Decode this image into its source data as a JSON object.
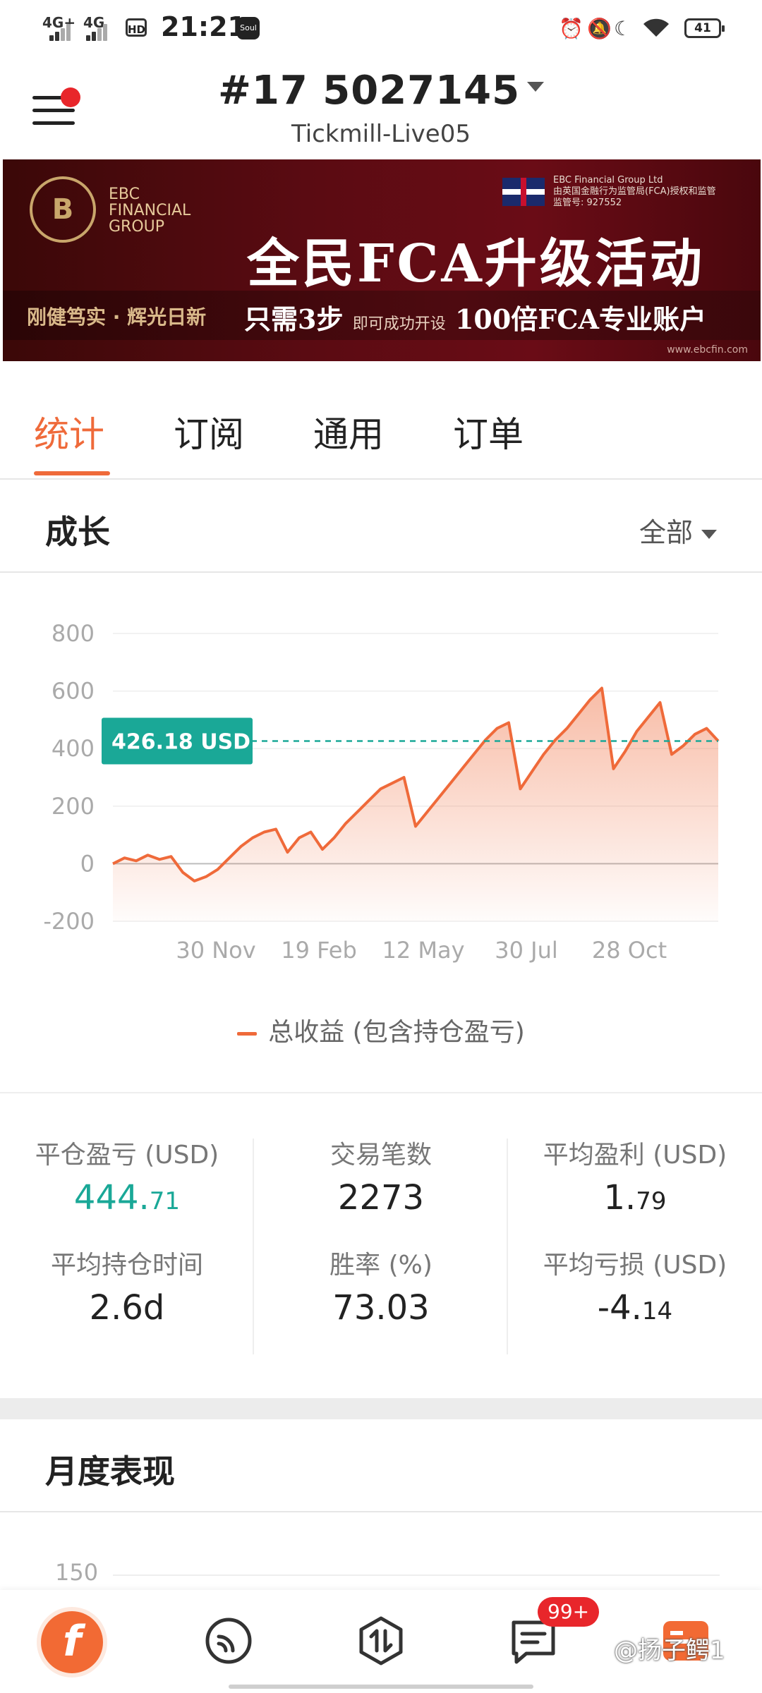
{
  "status_bar": {
    "net1": "4G+",
    "net2": "4G",
    "time": "21:21",
    "hd": "HD",
    "app_badge": "Soul",
    "battery": "41"
  },
  "header": {
    "account_title": "#17  5027145",
    "server": "Tickmill-Live05"
  },
  "banner": {
    "logo_text_1": "EBC",
    "logo_text_2": "FINANCIAL",
    "logo_text_3": "GROUP",
    "reg_line1": "EBC Financial Group Ltd",
    "reg_line2": "由英国金融行为监管局(FCA)授权和监管",
    "reg_line3": "监管号: 927552",
    "headline": "全民FCA升级活动",
    "slogan": "刚健笃实 · 辉光日新",
    "steps_main": "只需3步",
    "steps_small": "即可成功开设",
    "steps_tail": "100倍FCA专业账户",
    "url": "www.ebcfin.com"
  },
  "tabs": [
    {
      "label": "统计",
      "active": true
    },
    {
      "label": "订阅",
      "active": false
    },
    {
      "label": "通用",
      "active": false
    },
    {
      "label": "订单",
      "active": false
    }
  ],
  "growth": {
    "title": "成长",
    "filter": "全部"
  },
  "chart_data": {
    "type": "area",
    "title": "",
    "y_ticks": [
      "800",
      "600",
      "400",
      "200",
      "0",
      "-200"
    ],
    "x_ticks": [
      "30 Nov",
      "19 Feb",
      "12 May",
      "30 Jul",
      "28 Oct"
    ],
    "ylim": [
      -200,
      800
    ],
    "current_label": "426.18 USD",
    "current_value": 426.18,
    "series": [
      {
        "name": "总收益 (包含持仓盈亏)",
        "color": "#ef6a3a",
        "values": [
          0,
          20,
          10,
          30,
          15,
          25,
          -30,
          -60,
          -45,
          -20,
          20,
          60,
          90,
          110,
          120,
          40,
          90,
          110,
          50,
          90,
          140,
          180,
          220,
          260,
          280,
          300,
          130,
          180,
          230,
          280,
          330,
          380,
          430,
          470,
          490,
          260,
          320,
          380,
          430,
          470,
          520,
          570,
          610,
          330,
          390,
          460,
          510,
          560,
          380,
          410,
          450,
          470,
          426.18
        ]
      }
    ]
  },
  "stats": [
    {
      "label": "平仓盈亏 (USD)",
      "value_main": "444.",
      "value_small": "71",
      "green": true
    },
    {
      "label": "交易笔数",
      "value_main": "2273",
      "value_small": ""
    },
    {
      "label": "平均盈利 (USD)",
      "value_main": "1.",
      "value_small": "79"
    },
    {
      "label": "平均持仓时间",
      "value_main": "2.6d",
      "value_small": ""
    },
    {
      "label": "胜率 (%)",
      "value_main": "73.03",
      "value_small": ""
    },
    {
      "label": "平均亏损 (USD)",
      "value_main": "-4.",
      "value_small": "14"
    }
  ],
  "monthly": {
    "title": "月度表现",
    "first_tick": "150"
  },
  "bottom_nav": {
    "badge": "99+",
    "watermark": "@扬子鳄1"
  },
  "colors": {
    "accent": "#ef6a3a",
    "green": "#1aa897",
    "badge_red": "#e8262b"
  }
}
